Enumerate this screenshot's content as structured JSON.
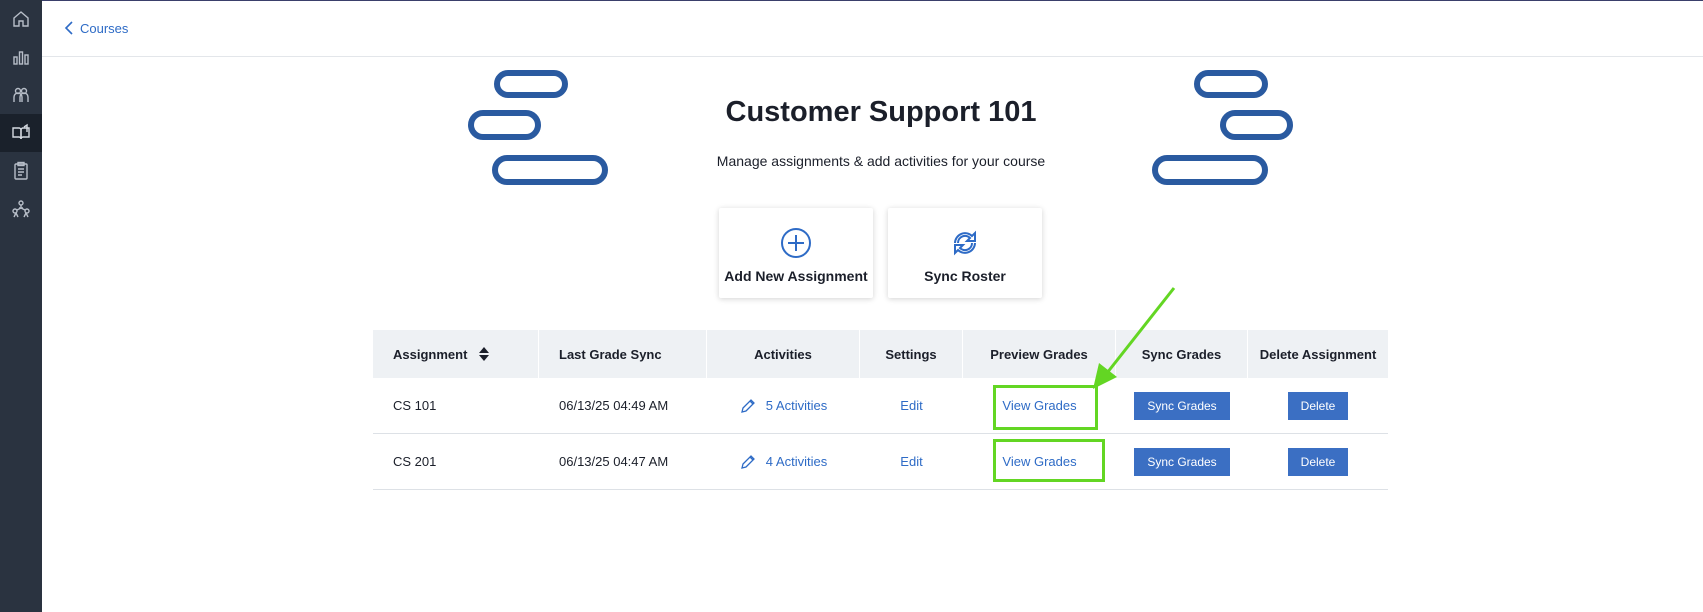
{
  "nav": {
    "back_label": "Courses",
    "sidebar_items": [
      {
        "icon": "home-icon"
      },
      {
        "icon": "bar-chart-icon"
      },
      {
        "icon": "users-icon"
      },
      {
        "icon": "book-icon",
        "active": true
      },
      {
        "icon": "clipboard-icon"
      },
      {
        "icon": "people-network-icon"
      }
    ]
  },
  "course": {
    "title": "Customer Support 101",
    "subtitle": "Manage assignments & add activities for your course"
  },
  "actions": {
    "add_assignment": "Add New Assignment",
    "sync_roster": "Sync Roster"
  },
  "table": {
    "headers": [
      "Assignment",
      "Last Grade Sync",
      "Activities",
      "Settings",
      "Preview Grades",
      "Sync Grades",
      "Delete Assignment"
    ],
    "rows": [
      {
        "name": "CS 101",
        "last_sync": "06/13/25 04:49 AM",
        "activities": "5 Activities",
        "settings": "Edit",
        "preview": "View Grades",
        "sync": "Sync Grades",
        "delete": "Delete"
      },
      {
        "name": "CS 201",
        "last_sync": "06/13/25 04:47 AM",
        "activities": "4 Activities",
        "settings": "Edit",
        "preview": "View Grades",
        "sync": "Sync Grades",
        "delete": "Delete"
      }
    ]
  },
  "colors": {
    "accent": "#2e6bc6",
    "button": "#3b6fc3",
    "sidebar": "#2a3340",
    "highlight": "#63d623",
    "pill": "#2a5aa0"
  }
}
